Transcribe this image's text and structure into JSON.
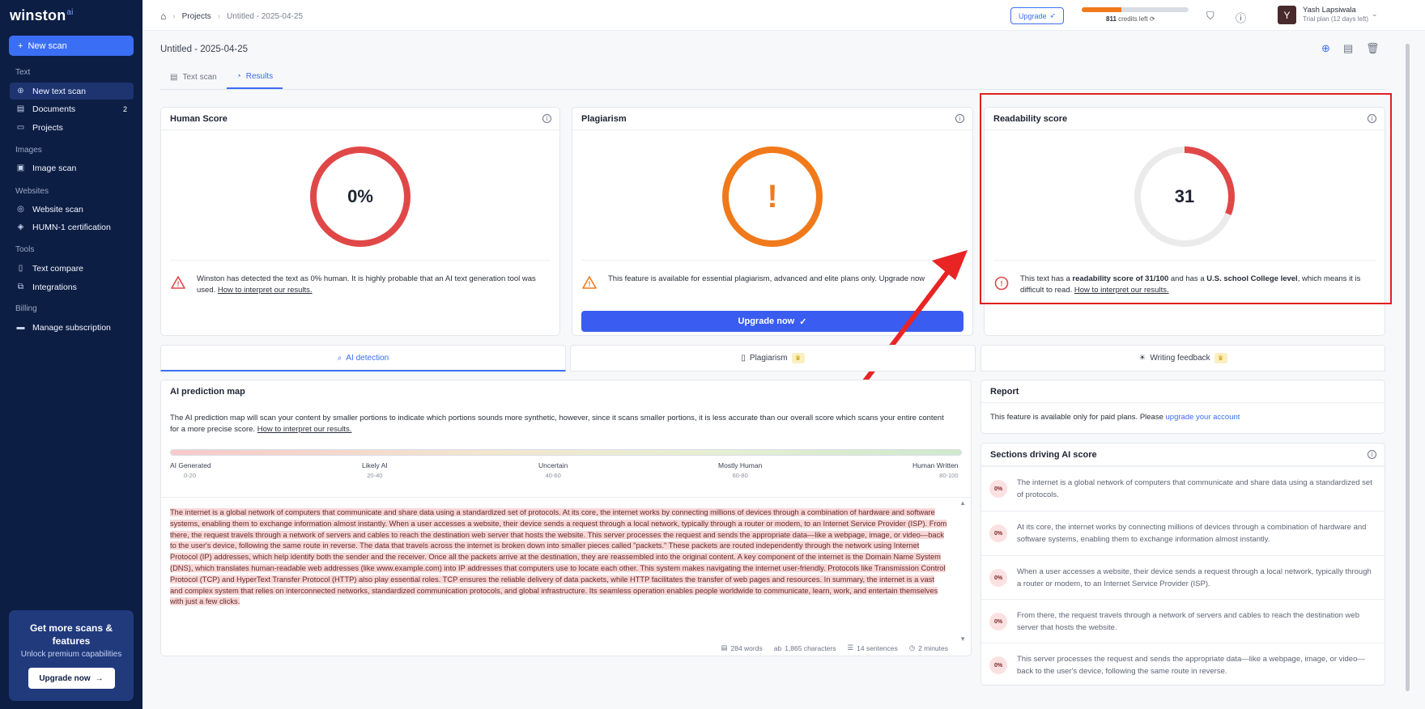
{
  "sidebar": {
    "logo": "winston",
    "logo_sup": "ai",
    "new_scan": "New scan",
    "sections": [
      {
        "label": "Text"
      },
      {
        "label": "Images"
      },
      {
        "label": "Websites"
      },
      {
        "label": "Tools"
      },
      {
        "label": "Billing"
      }
    ],
    "items": [
      {
        "label": "New text scan",
        "icon": "plus-circle-icon",
        "active": true
      },
      {
        "label": "Documents",
        "icon": "document-icon",
        "badge": "2"
      },
      {
        "label": "Projects",
        "icon": "folder-icon"
      },
      {
        "label": "Image scan",
        "icon": "image-icon"
      },
      {
        "label": "Website scan",
        "icon": "globe-icon"
      },
      {
        "label": "HUMN-1 certification",
        "icon": "certificate-icon"
      },
      {
        "label": "Text compare",
        "icon": "book-icon"
      },
      {
        "label": "Integrations",
        "icon": "integrations-icon"
      },
      {
        "label": "Manage subscription",
        "icon": "card-icon"
      }
    ],
    "promo": {
      "title": "Get more scans & features",
      "subtitle": "Unlock premium capabilities",
      "button": "Upgrade now"
    }
  },
  "topbar": {
    "breadcrumb": [
      "Projects",
      "Untitled - 2025-04-25"
    ],
    "upgrade": "Upgrade",
    "credits_value": "811",
    "credits_label": "credits left",
    "credits_fraction": 0.37,
    "user_initial": "Y",
    "user_name": "Yash Lapsiwala",
    "user_plan": "Trial plan (12 days left)"
  },
  "doc": {
    "title": "Untitled - 2025-04-25"
  },
  "tabs": [
    {
      "label": "Text scan",
      "icon": "clipboard-icon"
    },
    {
      "label": "Results",
      "icon": "results-icon",
      "active": true
    }
  ],
  "cards": {
    "human": {
      "title": "Human Score",
      "value": "0%",
      "message": "Winston has detected the text as 0% human. It is highly probable that an AI text generation tool was used.",
      "link": "How to interpret our results.",
      "ring_color": "#e04848"
    },
    "plagiarism": {
      "title": "Plagiarism",
      "symbol": "!",
      "message": "This feature is available for essential plagiarism, advanced and elite plans only. Upgrade now",
      "button": "Upgrade now",
      "ring_color": "#f07a1b"
    },
    "readability": {
      "title": "Readability score",
      "value": "31",
      "score_fraction": 0.31,
      "message_pre": "This text has a ",
      "message_b1": "readability score of 31/100",
      "message_mid": " and has a ",
      "message_b2": "U.S. school College level",
      "message_post": ", which means it is difficult to read.",
      "link": "How to interpret our results.",
      "ring_color": "#e04848"
    }
  },
  "section_tabs": [
    {
      "label": "AI detection",
      "icon": "search-icon",
      "active": true
    },
    {
      "label": "Plagiarism",
      "icon": "book-icon",
      "crown": true
    },
    {
      "label": "Writing feedback",
      "icon": "bulb-icon",
      "crown": true
    }
  ],
  "prediction_map": {
    "title": "AI prediction map",
    "description": "The AI prediction map will scan your content by smaller portions to indicate which portions sounds more synthetic, however, since it scans smaller portions, it is less accurate than our overall score which scans your entire content for a more precise score.",
    "link": "How to interpret our results.",
    "legend": [
      {
        "label": "AI Generated",
        "range": "0-20"
      },
      {
        "label": "Likely AI",
        "range": "20-40"
      },
      {
        "label": "Uncertain",
        "range": "40-60"
      },
      {
        "label": "Mostly Human",
        "range": "60-80"
      },
      {
        "label": "Human Written",
        "range": "80-100"
      }
    ],
    "text": "The internet is a global network of computers that communicate and share data using a standardized set of protocols. At its core, the internet works by connecting millions of devices through a combination of hardware and software systems, enabling them to exchange information almost instantly. When a user accesses a website, their device sends a request through a local network, typically through a router or modem, to an Internet Service Provider (ISP). From there, the request travels through a network of servers and cables to reach the destination web server that hosts the website. This server processes the request and sends the appropriate data—like a webpage, image, or video—back to the user's device, following the same route in reverse. The data that travels across the internet is broken down into smaller pieces called \"packets.\" These packets are routed independently through the network using Internet Protocol (IP) addresses, which help identify both the sender and the receiver. Once all the packets arrive at the destination, they are reassembled into the original content. A key component of the internet is the Domain Name System (DNS), which translates human-readable web addresses (like www.example.com) into IP addresses that computers use to locate each other. This system makes navigating the internet user-friendly. Protocols like Transmission Control Protocol (TCP) and HyperText Transfer Protocol (HTTP) also play essential roles. TCP ensures the reliable delivery of data packets, while HTTP facilitates the transfer of web pages and resources. In summary, the internet is a vast and complex system that relies on interconnected networks, standardized communication protocols, and global infrastructure. Its seamless operation enables people worldwide to communicate, learn, work, and entertain themselves with just a few clicks.",
    "stats": {
      "words": "284 words",
      "characters": "1,865 characters",
      "sentences": "14 sentences",
      "time": "2 minutes"
    }
  },
  "report": {
    "title": "Report",
    "text": "This feature is available only for paid plans. Please ",
    "link": "upgrade your account"
  },
  "sections_driving": {
    "title": "Sections driving AI score",
    "rows": [
      {
        "score": "0%",
        "text": "The internet is a global network of computers that communicate and share data using a standardized set of protocols."
      },
      {
        "score": "0%",
        "text": "At its core, the internet works by connecting millions of devices through a combination of hardware and software systems, enabling them to exchange information almost instantly."
      },
      {
        "score": "0%",
        "text": "When a user accesses a website, their device sends a request through a local network, typically through a router or modem, to an Internet Service Provider (ISP)."
      },
      {
        "score": "0%",
        "text": "From there, the request travels through a network of servers and cables to reach the destination web server that hosts the website."
      },
      {
        "score": "0%",
        "text": "This server processes the request and sends the appropriate data—like a webpage, image, or video—back to the user's device, following the same route in reverse."
      }
    ]
  }
}
